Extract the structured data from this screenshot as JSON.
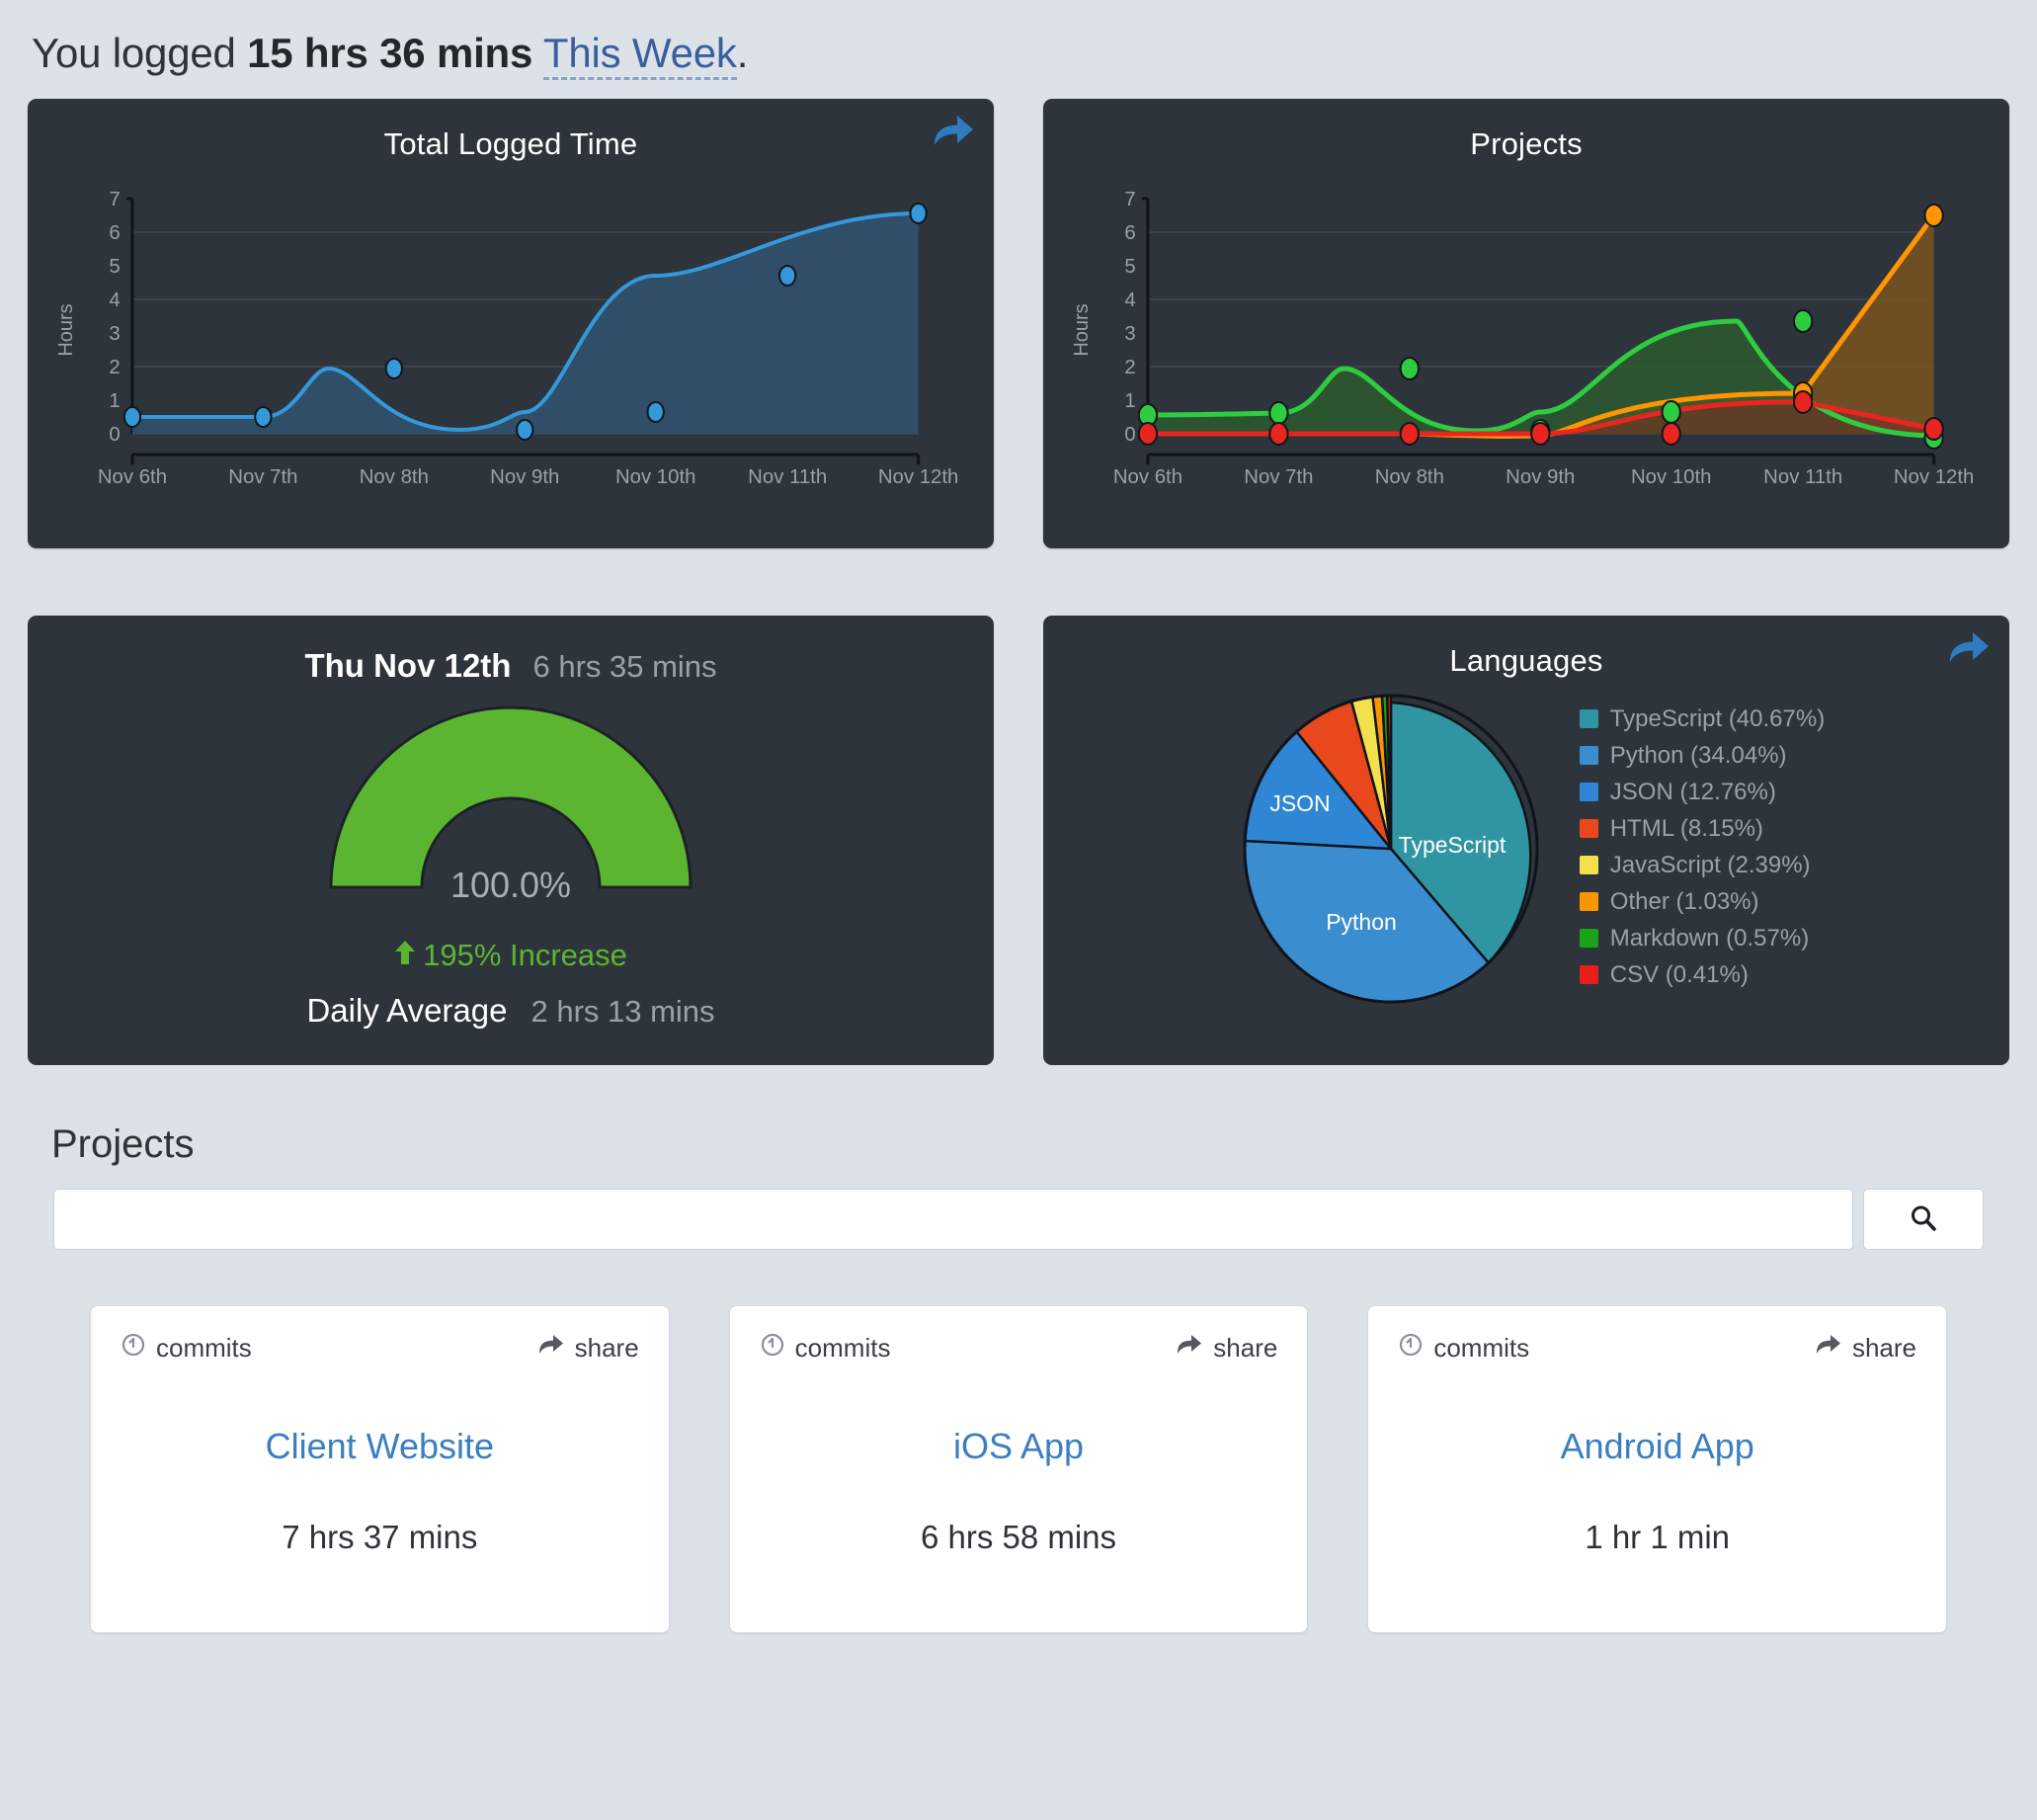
{
  "headline": {
    "prefix": "You logged ",
    "duration": "15 hrs 36 mins",
    "range_link": "This Week",
    "suffix": "."
  },
  "colors": {
    "card_bg": "#2d343c",
    "page_bg": "#dde2e9",
    "accent_blue": "#3a7fc1",
    "link_blue": "#3a5f9e",
    "green": "#5cb531",
    "series_blue": "#3498db",
    "series_green": "#2ecc40",
    "series_red": "#e8251f",
    "series_orange": "#ff9500"
  },
  "total_card": {
    "title": "Total Logged Time",
    "share_icon": "share-arrow-icon"
  },
  "projects_chart_card": {
    "title": "Projects"
  },
  "gauge_card": {
    "day_label": "Thu Nov 12th",
    "day_total": "6 hrs 35 mins",
    "percent": "100.0%",
    "change": "195% Increase",
    "change_arrow": "arrow-up-icon",
    "average_label": "Daily Average",
    "average_value": "2 hrs 13 mins",
    "gauge_fill_pct": 100
  },
  "languages_card": {
    "title": "Languages",
    "share_icon": "share-arrow-icon"
  },
  "projects_section": {
    "title": "Projects",
    "search_value": "",
    "search_placeholder": "",
    "search_icon": "search-icon",
    "cards": [
      {
        "commits_label": "commits",
        "share_label": "share",
        "name": "Client Website",
        "time": "7 hrs 37 mins"
      },
      {
        "commits_label": "commits",
        "share_label": "share",
        "name": "iOS App",
        "time": "6 hrs 58 mins"
      },
      {
        "commits_label": "commits",
        "share_label": "share",
        "name": "Android App",
        "time": "1 hr 1 min"
      }
    ]
  },
  "chart_data": [
    {
      "id": "total_logged_time",
      "type": "area",
      "title": "Total Logged Time",
      "xlabel": "",
      "ylabel": "Hours",
      "categories": [
        "Nov 6th",
        "Nov 7th",
        "Nov 8th",
        "Nov 9th",
        "Nov 10th",
        "Nov 11th",
        "Nov 12th"
      ],
      "yticks": [
        0,
        1,
        2,
        3,
        4,
        5,
        6,
        7
      ],
      "ylim": [
        0,
        7
      ],
      "grid": true,
      "legend": "none",
      "series": [
        {
          "name": "Total Logged Time",
          "color": "#3498db",
          "values": [
            0.5,
            0.5,
            1.95,
            0.15,
            0.65,
            5.4,
            6.55
          ]
        }
      ]
    },
    {
      "id": "projects",
      "type": "area",
      "title": "Projects",
      "xlabel": "",
      "ylabel": "Hours",
      "categories": [
        "Nov 6th",
        "Nov 7th",
        "Nov 8th",
        "Nov 9th",
        "Nov 10th",
        "Nov 11th",
        "Nov 12th"
      ],
      "yticks": [
        0,
        1,
        2,
        3,
        4,
        5,
        6,
        7
      ],
      "ylim": [
        0,
        7
      ],
      "grid": true,
      "legend": "none",
      "series": [
        {
          "name": "Client Website",
          "color": "#2ecc40",
          "values": [
            0.55,
            0.6,
            1.95,
            0.15,
            0.65,
            3.35,
            0.0
          ]
        },
        {
          "name": "iOS App",
          "color": "#e8251f",
          "values": [
            0.0,
            0.0,
            0.0,
            0.0,
            0.0,
            0.95,
            0.15
          ]
        },
        {
          "name": "Android App",
          "color": "#ff9500",
          "values": [
            0.0,
            0.0,
            0.0,
            0.0,
            0.0,
            1.2,
            6.5
          ]
        }
      ]
    },
    {
      "id": "languages",
      "type": "pie",
      "title": "Languages",
      "labels_on_slices": [
        "TypeScript",
        "Python",
        "JSON"
      ],
      "slices": [
        {
          "label": "TypeScript",
          "value": 40.67,
          "legend": "TypeScript (40.67%)",
          "color": "#3095a3"
        },
        {
          "label": "Python",
          "value": 34.04,
          "legend": "Python (34.04%)",
          "color": "#3a8ed0"
        },
        {
          "label": "JSON",
          "value": 12.76,
          "legend": "JSON (12.76%)",
          "color": "#2f86d4"
        },
        {
          "label": "HTML",
          "value": 8.15,
          "legend": "HTML (8.15%)",
          "color": "#e8481c"
        },
        {
          "label": "JavaScript",
          "value": 2.39,
          "legend": "JavaScript (2.39%)",
          "color": "#f4e04d"
        },
        {
          "label": "Other",
          "value": 1.03,
          "legend": "Other (1.03%)",
          "color": "#fa9600"
        },
        {
          "label": "Markdown",
          "value": 0.57,
          "legend": "Markdown (0.57%)",
          "color": "#19a319"
        },
        {
          "label": "CSV",
          "value": 0.41,
          "legend": "CSV (0.41%)",
          "color": "#e8201c"
        }
      ]
    },
    {
      "id": "daily_gauge",
      "type": "gauge",
      "title": "Thu Nov 12th",
      "value": 100.0,
      "unit": "%",
      "range": [
        0,
        100
      ],
      "color": "#5cb531"
    }
  ]
}
